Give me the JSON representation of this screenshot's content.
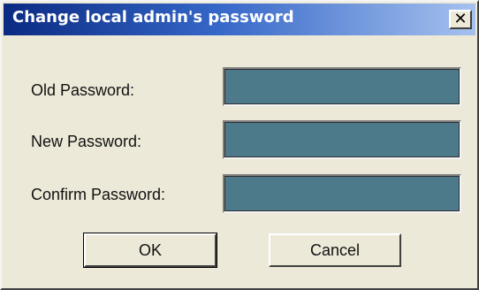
{
  "dialog": {
    "title": "Change local admin's password",
    "close_glyph": "✕"
  },
  "fields": {
    "old_password": {
      "label": "Old Password:",
      "value": ""
    },
    "new_password": {
      "label": "New Password:",
      "value": ""
    },
    "confirm_password": {
      "label": "Confirm Password:",
      "value": ""
    }
  },
  "buttons": {
    "ok_label": "OK",
    "cancel_label": "Cancel"
  },
  "colors": {
    "titlebar_start": "#0b2a82",
    "titlebar_end": "#a6c1ee",
    "field_background": "#4d7a8b",
    "dialog_background": "#ece9d8"
  }
}
